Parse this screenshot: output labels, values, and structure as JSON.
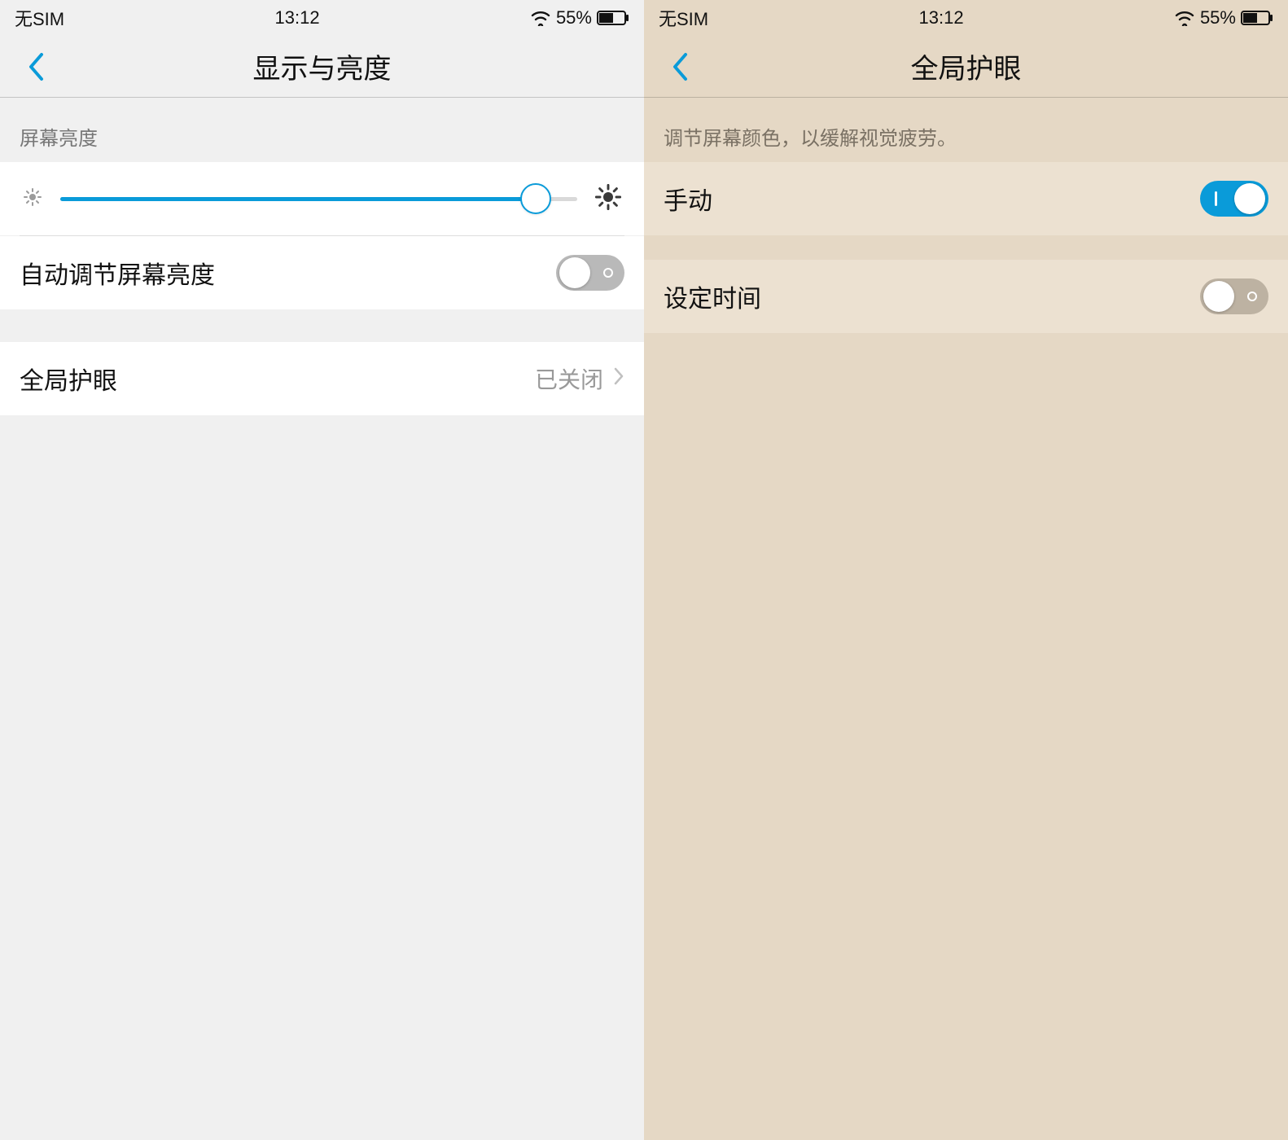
{
  "left": {
    "status": {
      "sim": "无SIM",
      "time": "13:12",
      "battery": "55%"
    },
    "title": "显示与亮度",
    "section_brightness_label": "屏幕亮度",
    "slider_percent": 92,
    "auto_brightness_label": "自动调节屏幕亮度",
    "auto_brightness_on": false,
    "eye_care_label": "全局护眼",
    "eye_care_value": "已关闭"
  },
  "right": {
    "status": {
      "sim": "无SIM",
      "time": "13:12",
      "battery": "55%"
    },
    "title": "全局护眼",
    "description": "调节屏幕颜色，以缓解视觉疲劳。",
    "manual_label": "手动",
    "manual_on": true,
    "schedule_label": "设定时间",
    "schedule_on": false
  },
  "colors": {
    "accent": "#0a9bd9",
    "left_bg": "#f0f0f0",
    "right_bg": "#e5d8c5",
    "right_row": "#ece1d1"
  }
}
